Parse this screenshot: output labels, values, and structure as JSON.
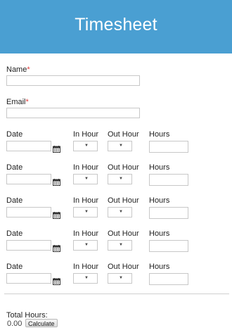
{
  "form": {
    "title": "Timesheet",
    "name_label": "Name",
    "email_label": "Email",
    "required_marker": "*",
    "name_value": "",
    "email_value": ""
  },
  "columns": {
    "date": "Date",
    "in_hour": "In Hour",
    "out_hour": "Out Hour",
    "hours": "Hours"
  },
  "rows": [
    {
      "date": "",
      "in_hour": "",
      "out_hour": "",
      "hours": ""
    },
    {
      "date": "",
      "in_hour": "",
      "out_hour": "",
      "hours": ""
    },
    {
      "date": "",
      "in_hour": "",
      "out_hour": "",
      "hours": ""
    },
    {
      "date": "",
      "in_hour": "",
      "out_hour": "",
      "hours": ""
    },
    {
      "date": "",
      "in_hour": "",
      "out_hour": "",
      "hours": ""
    }
  ],
  "icons": {
    "calendar": "calendar-icon",
    "select_arrow": "chevron-down-icon"
  },
  "colors": {
    "header_bg": "#4a9fd2",
    "required": "#e23b3b"
  },
  "footer": {
    "total_label": "Total Hours:",
    "total_value": "0.00",
    "calculate_label": "Calculate"
  }
}
